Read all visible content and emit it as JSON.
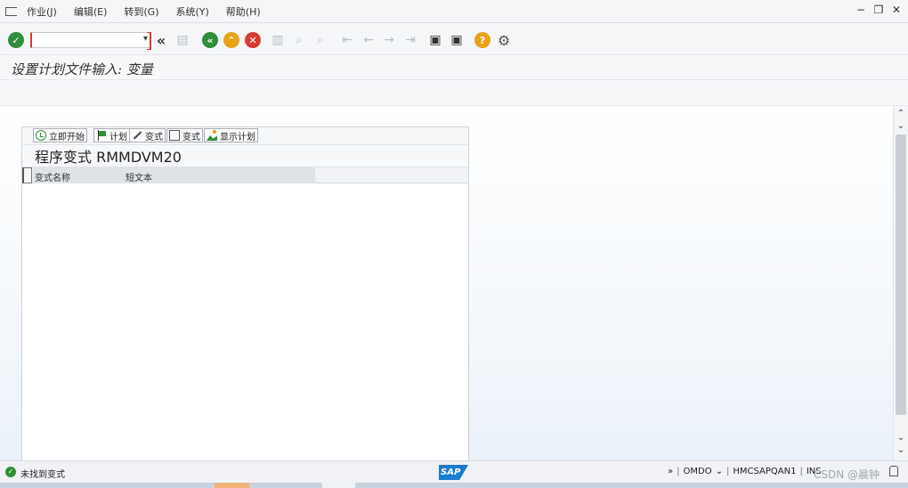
{
  "menu": {
    "items": [
      "作业(J)",
      "编辑(E)",
      "转到(G)",
      "系统(Y)",
      "帮助(H)"
    ],
    "window_controls": [
      "−",
      "❐",
      "✕"
    ]
  },
  "toolbar": {
    "command_field": {
      "value": "",
      "placeholder": ""
    },
    "icons": {
      "enter": "check-icon",
      "back": "back-icon",
      "exit": "exit-icon",
      "cancel": "cancel-icon",
      "help": "help-icon",
      "settings": "gear-icon"
    },
    "glyphs": {
      "enter": "✓",
      "history": "«",
      "save": "▤",
      "back": "«",
      "exit": "⌃",
      "cancel": "✕",
      "print": "▥",
      "find": "⌕",
      "find_next": "⌕",
      "first": "⇤",
      "prev": "←",
      "next": "→",
      "last": "⇥",
      "new_session": "▣",
      "shortcut": "▣",
      "help": "?",
      "settings": "⚙"
    }
  },
  "title": {
    "text": "设置计划文件输入: 变量"
  },
  "panel": {
    "buttons": [
      {
        "label": "立即开始",
        "icon": "clock-icon"
      },
      {
        "label": "计划",
        "icon": "flag-icon"
      },
      {
        "label": "变式",
        "icon": "pencil-icon"
      },
      {
        "label": "变式",
        "icon": "document-icon"
      },
      {
        "label": "显示计划",
        "icon": "chart-icon"
      }
    ],
    "variant_title": "程序变式 RMMDVM20",
    "columns": [
      "变式名称",
      "短文本"
    ]
  },
  "status": {
    "message": "未找到变式",
    "sap_logo": "SAP",
    "more": "»",
    "transaction": "OMDO",
    "server": "HMCSAPQAN1",
    "mode": "INS",
    "watermark": "CSDN @晨钟"
  },
  "colors": {
    "green": "#2f8f3a",
    "amber": "#e8a317",
    "red": "#d63b2f",
    "sap_blue": "#1a7ccf"
  }
}
